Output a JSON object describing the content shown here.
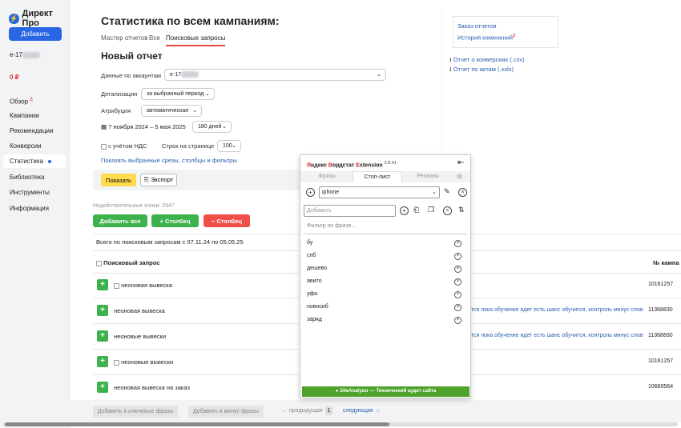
{
  "sidebar": {
    "logo": "Директ Про",
    "add_button": "Добавить",
    "account": "e-17",
    "balance": "0 ₽",
    "nav": [
      {
        "label": "Обзор",
        "badge": "β"
      },
      {
        "label": "Кампании"
      },
      {
        "label": "Рекомендации"
      },
      {
        "label": "Конверсии"
      },
      {
        "label": "Статистика"
      },
      {
        "label": "Библиотека"
      },
      {
        "label": "Инструменты"
      },
      {
        "label": "Информация"
      }
    ]
  },
  "header": {
    "title": "Статистика по всем кампаниям:",
    "tabs": [
      "Мастер отчетов",
      "Все",
      "Поисковые запросы"
    ]
  },
  "right_links": {
    "order_reports": "Заказ отчетов",
    "history": "История изменений",
    "history_badge": "β",
    "conv_report": "Отчет о конверсиях (.csv)",
    "acts_report": "Отчет по актам (.xslx)"
  },
  "report": {
    "title": "Новый отчет",
    "accounts_label": "Данные по аккаунтам",
    "accounts_value": "e-17",
    "detail_label": "Детализация",
    "detail_value": "за выбранный период",
    "attribution_label": "Атрибуция",
    "attribution_value": "автоматическая",
    "date_range": "7 ноября 2024 – 5 мая 2025",
    "period": "180 дней",
    "vat_label": "с учётом НДС",
    "rows_label": "Строк на странице",
    "rows_value": "100",
    "show_link": "Показать выбранные срезы, столбцы и фильтры",
    "show_btn": "Показать",
    "export_btn": "Экспорт"
  },
  "table": {
    "invalid_clicks": "Недействительные клики: 2947",
    "add_all": "Добавить все",
    "add_col": "+ Столбец",
    "remove_col": "− Столбец",
    "summary": "Всего по поисковым запросам с 07.11.24 по 05.05.25",
    "col_query": "Поисковый запрос",
    "col_campaign": "№ кампа",
    "rows": [
      {
        "query": "неоновая вывеска",
        "checkbox": true,
        "note": "",
        "campaign": "10161257"
      },
      {
        "query": "неоновая вывеска",
        "checkbox": false,
        "note": "тся пока обучение идет есть шанс обучится, контроль минус слов",
        "campaign": "11368830"
      },
      {
        "query": "неоновые вывески",
        "checkbox": false,
        "note": "тся пока обучение идет есть шанс обучится, контроль минус слов",
        "campaign": "11368830"
      },
      {
        "query": "неоновые вывески",
        "checkbox": true,
        "note": "",
        "campaign": "10161257"
      },
      {
        "query": "неоновая вывеска на заказ",
        "checkbox": false,
        "note": "",
        "campaign": "10689564"
      }
    ]
  },
  "bottom": {
    "to_keywords": "Добавить в ключевые фразы",
    "to_minus": "Добавить в минус-фразы",
    "prev": "← предыдущая",
    "page": "1",
    "next": "следующая →"
  },
  "extension": {
    "title_y": "Я",
    "title_1": "ндекс ",
    "title_w": "В",
    "title_2": "ордстат ",
    "title_e": "E",
    "title_3": "xtension",
    "version": "2.8.41",
    "tabs": [
      "Фразы",
      "Стоп-лист",
      "Регионы"
    ],
    "list_value": "iphone",
    "add_placeholder": "Добавить",
    "filter_placeholder": "Фильтр по фразе...",
    "words": [
      "бу",
      "спб",
      "дешево",
      "авито",
      "уфа",
      "новосиб",
      "заряд"
    ],
    "footer": "SiteAnalyzer — Технический аудит сайта"
  },
  "colors": {
    "accent_blue": "#2866e4",
    "green": "#3db24c",
    "red": "#ef4f48",
    "yellow": "#ffdb4d"
  }
}
